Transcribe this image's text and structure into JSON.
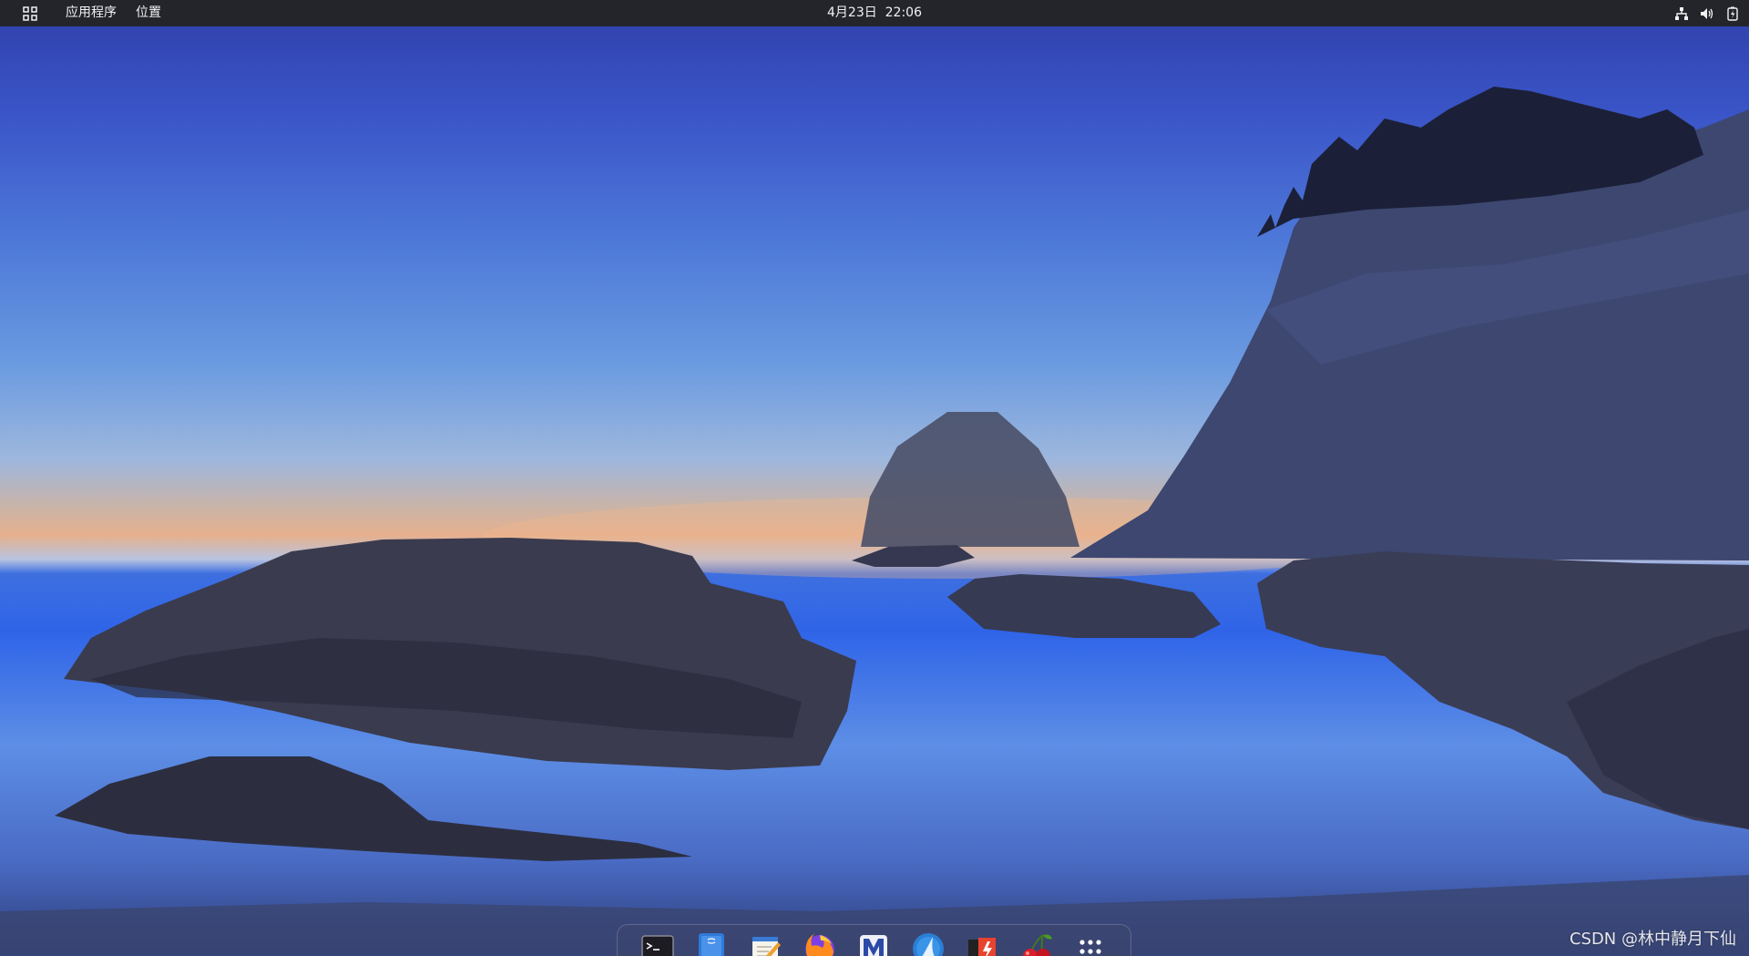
{
  "topbar": {
    "apps_label": "应用程序",
    "places_label": "位置",
    "clock": "4月23日  22:06",
    "tray_icons": [
      "network-icon",
      "volume-icon",
      "battery-icon"
    ]
  },
  "wallpaper": {
    "subject": "coastal rocks at dusk",
    "colors": {
      "sky_top": "#2f3fa8",
      "horizon_glow": "#e6b08e",
      "sea": "#2f64e8",
      "rock": "#3a3c52"
    }
  },
  "dock": {
    "apps": [
      {
        "name": "terminal-icon",
        "label": "Terminal"
      },
      {
        "name": "text-editor-icon",
        "label": "Text Editor"
      },
      {
        "name": "notes-icon",
        "label": "Notes"
      },
      {
        "name": "firefox-icon",
        "label": "Firefox"
      },
      {
        "name": "m-app-icon",
        "label": "M"
      },
      {
        "name": "browser-icon",
        "label": "Browser"
      },
      {
        "name": "app-store-icon",
        "label": "App Store"
      },
      {
        "name": "cherry-icon",
        "label": "Cherry"
      },
      {
        "name": "app-grid-icon",
        "label": "Show Applications"
      }
    ]
  },
  "watermark": "CSDN @林中静月下仙"
}
